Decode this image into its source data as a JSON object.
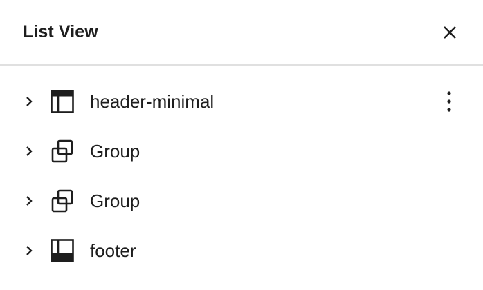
{
  "panel": {
    "title": "List View",
    "close_icon": "close-icon"
  },
  "items": [
    {
      "label": "header-minimal",
      "icon": "template-part-header-icon",
      "has_menu": true,
      "menu_icon": "more-vertical-icon"
    },
    {
      "label": "Group",
      "icon": "group-icon",
      "has_menu": false
    },
    {
      "label": "Group",
      "icon": "group-icon",
      "has_menu": false
    },
    {
      "label": "footer",
      "icon": "template-part-footer-icon",
      "has_menu": false
    }
  ],
  "colors": {
    "text": "#1e1e1e",
    "divider": "#e0e0e0",
    "background": "#ffffff"
  }
}
